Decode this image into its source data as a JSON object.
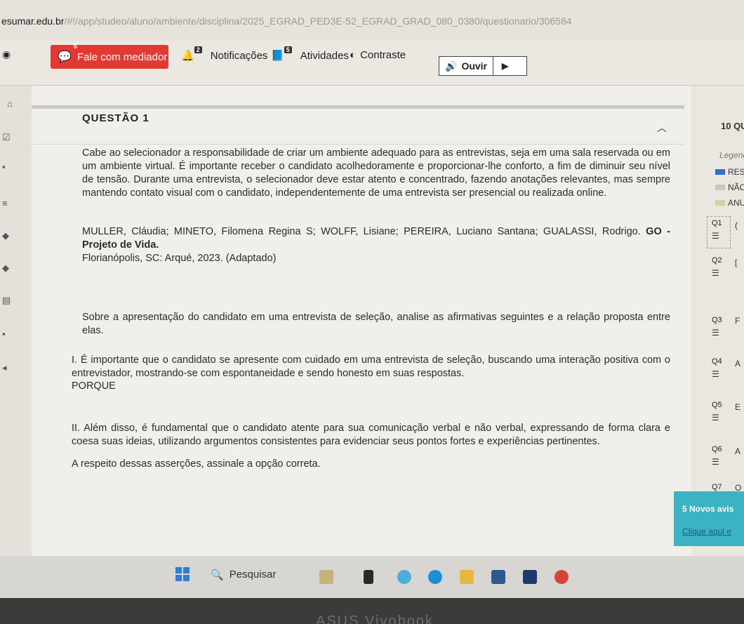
{
  "url": {
    "host": "esumar.edu.br",
    "path": "/#!/app/studeo/aluno/ambiente/disciplina/2025_EGRAD_PED3E-52_EGRAD_GRAD_080_0380/questionario/306584"
  },
  "toolbar": {
    "mediator_label": "Fale com mediador",
    "mediator_count": "5",
    "notifications_label": "Notificações",
    "notifications_count": "2",
    "activities_label": "Atividades",
    "activities_count": "5",
    "contrast_label": "Contraste",
    "listen_label": "Ouvir"
  },
  "question": {
    "title": "QUESTÃO 1",
    "p1": "Cabe ao selecionador a responsabilidade de criar um ambiente adequado para as entrevistas, seja em uma sala reservada ou em um ambiente virtual. É importante receber o candidato acolhedoramente e proporcionar-lhe conforto, a fim de diminuir seu nível de tensão. Durante uma entrevista, o selecionador deve estar atento e concentrado, fazendo anotações relevantes, mas sempre mantendo contato visual com o candidato, independentemente de uma entrevista ser presencial ou realizada online.",
    "citation_authors": "MULLER, Cláudia; MINETO, Filomena Regina S; WOLFF, Lisiane; PEREIRA, Luciano Santana; GUALASSI, Rodrigo.",
    "citation_work": "GO - Projeto de Vida.",
    "citation_place": "Florianópolis, SC: Arqué, 2023. (Adaptado)",
    "prompt": "Sobre a apresentação do candidato em uma entrevista de seleção, analise as afirmativas seguintes e a relação proposta entre elas.",
    "assertion1": "I. É importante que o candidato se apresente com cuidado em uma entrevista de seleção, buscando uma interação positiva com o entrevistador, mostrando-se com espontaneidade e sendo honesto em suas respostas.",
    "connector": "PORQUE",
    "assertion2": "II. Além disso, é fundamental que o candidato atente para sua comunicação verbal e não verbal, expressando de forma clara e coesa suas ideias, utilizando argumentos consistentes para evidenciar seus pontos fortes e experiências pertinentes.",
    "instruction": "A respeito dessas asserções, assinale a opção correta."
  },
  "side_panel": {
    "header": "10 QU",
    "legend_title": "Legend",
    "legend": [
      {
        "label": "RES",
        "color": "#2f6fd1"
      },
      {
        "label": "NÃO",
        "color": "#c9c6bf"
      },
      {
        "label": "ANU",
        "color": "#d8cf9e"
      }
    ],
    "questions": [
      {
        "num": "Q1",
        "letter": "("
      },
      {
        "num": "Q2",
        "letter": "["
      },
      {
        "num": "Q3",
        "letter": "F"
      },
      {
        "num": "Q4",
        "letter": "A"
      },
      {
        "num": "Q5",
        "letter": "E"
      },
      {
        "num": "Q6",
        "letter": "A"
      },
      {
        "num": "Q7",
        "letter": "O"
      }
    ],
    "notice_title": "5 Novos avis",
    "notice_link": "Clique aqui e"
  },
  "taskbar": {
    "search_label": "Pesquisar"
  },
  "bezel": {
    "brand": "ASUS Vivobook"
  }
}
